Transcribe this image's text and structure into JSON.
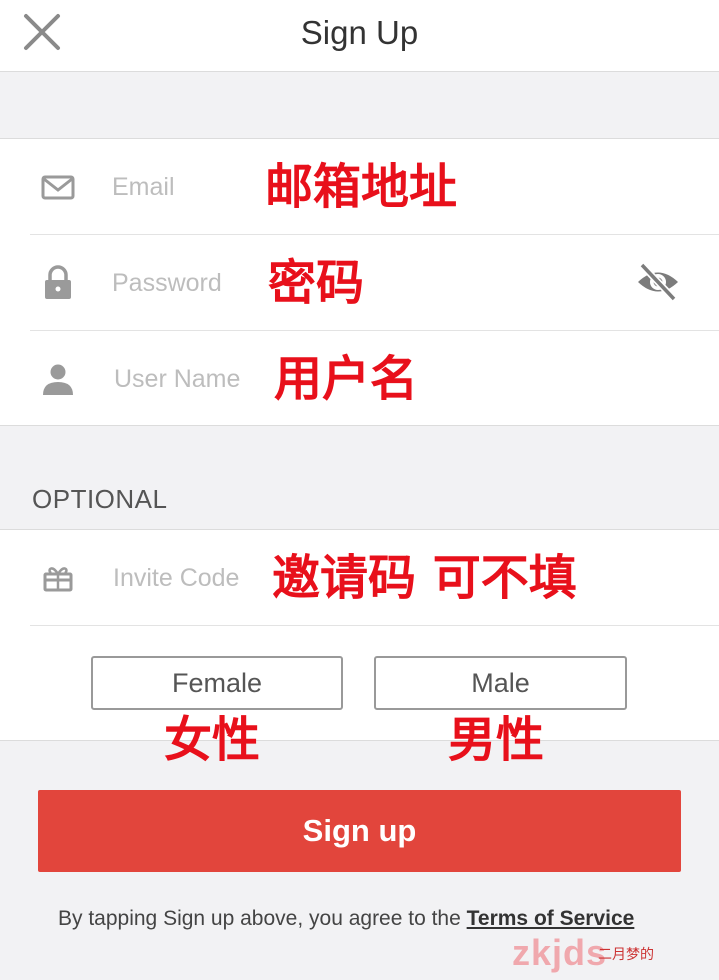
{
  "header": {
    "title": "Sign Up",
    "close_icon": "close-icon"
  },
  "form": {
    "email": {
      "placeholder": "Email",
      "icon": "mail-icon"
    },
    "password": {
      "placeholder": "Password",
      "icon": "lock-icon",
      "visibility_icon": "eye-slash-icon"
    },
    "username": {
      "placeholder": "User Name",
      "icon": "user-icon"
    },
    "optional_label": "OPTIONAL",
    "invite": {
      "placeholder": "Invite Code",
      "icon": "gift-icon"
    }
  },
  "gender": {
    "female_label": "Female",
    "male_label": "Male"
  },
  "annotations": {
    "email": "邮箱地址",
    "password": "密码",
    "username": "用户名",
    "invite": "邀请码 可不填",
    "female": "女性",
    "male": "男性"
  },
  "signup_button": "Sign up",
  "terms": {
    "prefix": "By tapping Sign up above, you agree to the ",
    "link": "Terms of Service"
  },
  "watermark": {
    "text": "zkjds",
    "sub": "二月梦的"
  },
  "colors": {
    "accent": "#e2453c",
    "annotation": "#e8101b",
    "background": "#f2f2f4"
  }
}
